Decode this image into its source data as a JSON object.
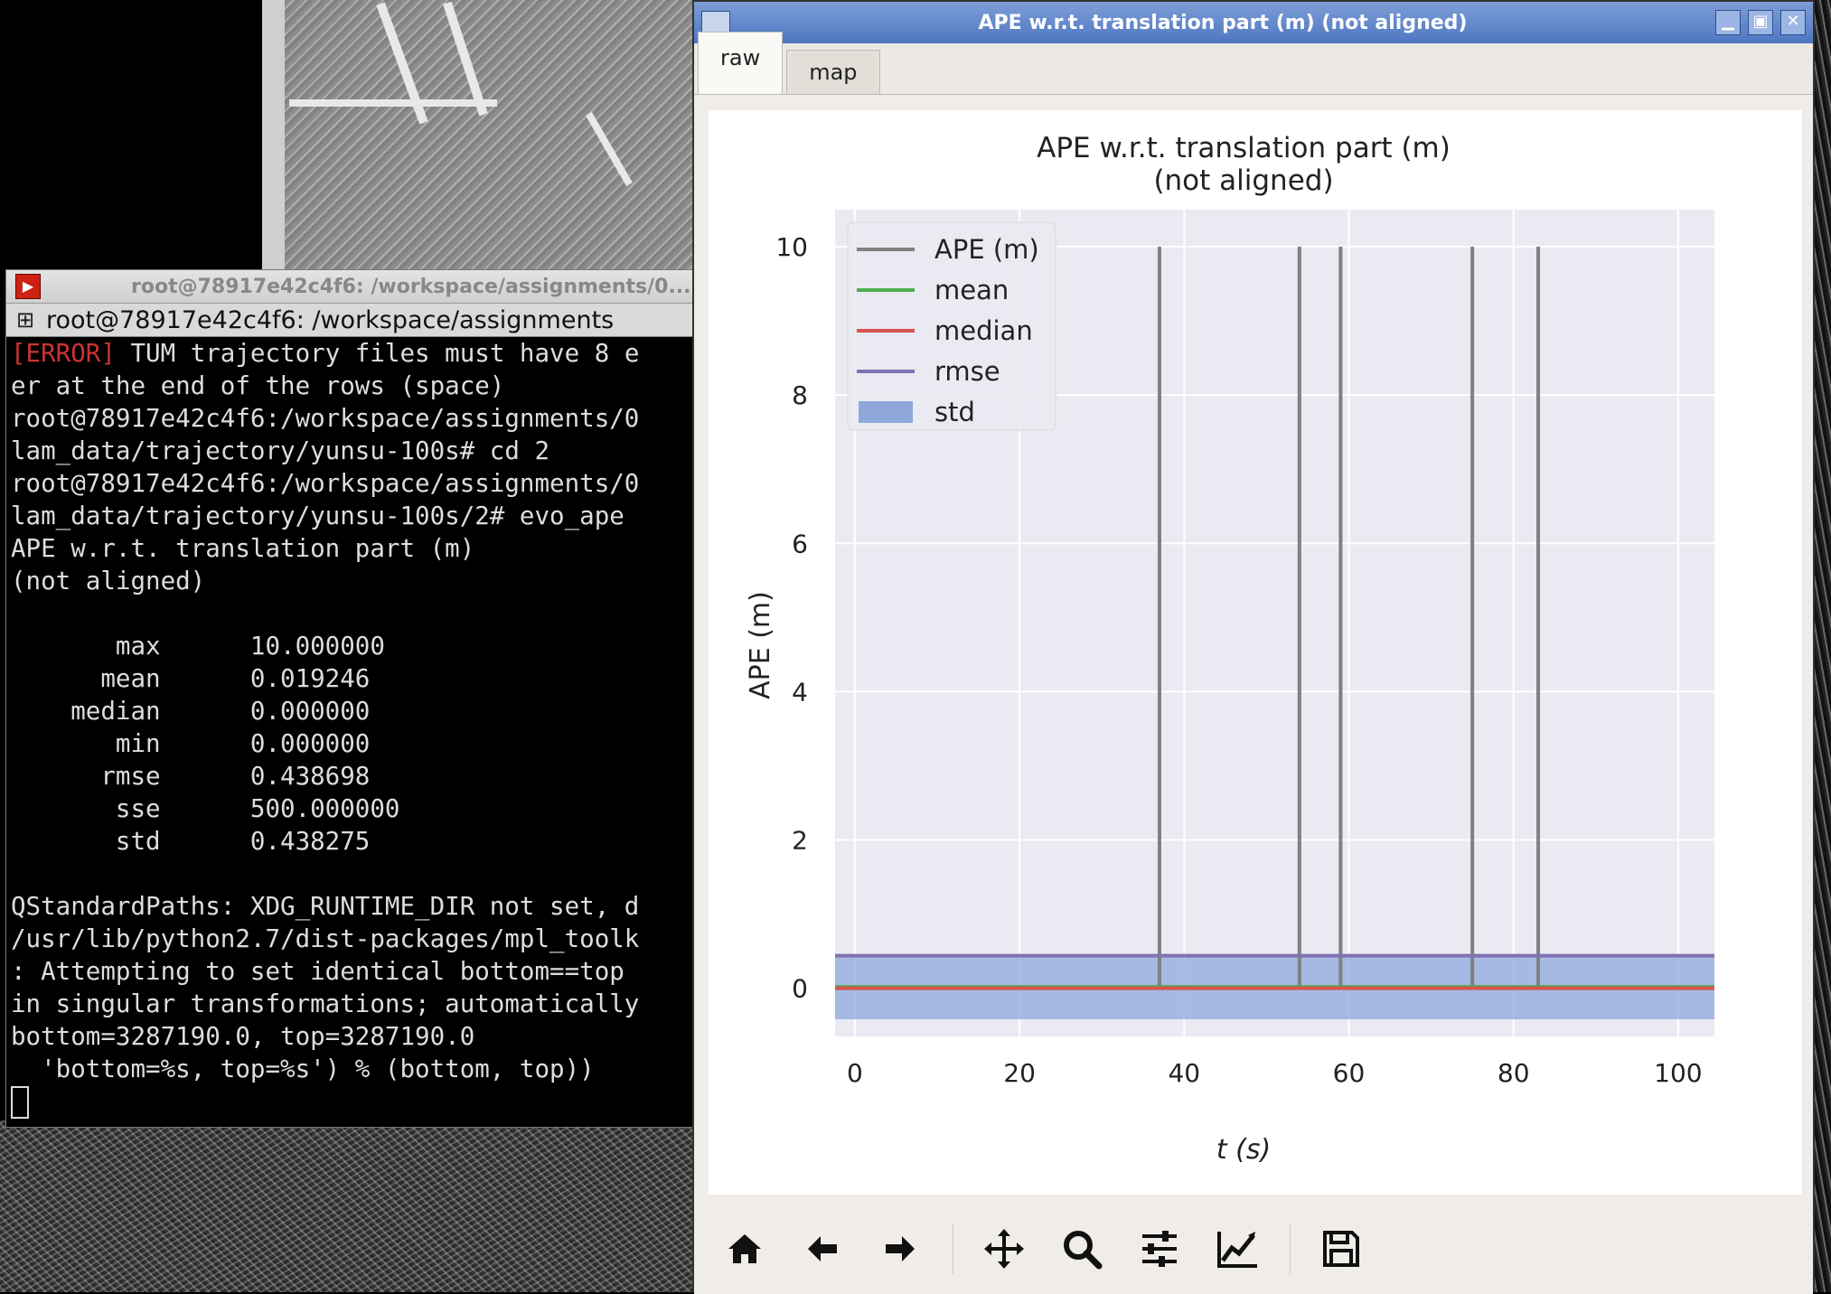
{
  "terminal": {
    "title": "root@78917e42c4f6: /workspace/assignments/0...",
    "tab_title": "root@78917e42c4f6: /workspace/assignments",
    "lines": [
      {
        "err": "[ERROR]",
        "text": " TUM trajectory files must have 8 e"
      },
      {
        "text": "er at the end of the rows (space)"
      },
      {
        "text": "root@78917e42c4f6:/workspace/assignments/0"
      },
      {
        "text": "lam_data/trajectory/yunsu-100s# cd 2"
      },
      {
        "text": "root@78917e42c4f6:/workspace/assignments/0"
      },
      {
        "text": "lam_data/trajectory/yunsu-100s/2# evo_ape "
      },
      {
        "text": "APE w.r.t. translation part (m)"
      },
      {
        "text": "(not aligned)"
      },
      {
        "text": ""
      },
      {
        "text": "       max      10.000000"
      },
      {
        "text": "      mean      0.019246"
      },
      {
        "text": "    median      0.000000"
      },
      {
        "text": "       min      0.000000"
      },
      {
        "text": "      rmse      0.438698"
      },
      {
        "text": "       sse      500.000000"
      },
      {
        "text": "       std      0.438275"
      },
      {
        "text": ""
      },
      {
        "text": "QStandardPaths: XDG_RUNTIME_DIR not set, d"
      },
      {
        "text": "/usr/lib/python2.7/dist-packages/mpl_toolk"
      },
      {
        "text": ": Attempting to set identical bottom==top "
      },
      {
        "text": "in singular transformations; automatically"
      },
      {
        "text": "bottom=3287190.0, top=3287190.0"
      },
      {
        "text": "  'bottom=%s, top=%s') % (bottom, top))"
      }
    ]
  },
  "plot_window": {
    "title": "APE w.r.t. translation part (m) (not aligned)",
    "tabs": [
      "raw",
      "map"
    ],
    "active_tab": "raw",
    "toolbar": [
      "home-icon",
      "back-icon",
      "forward-icon",
      "pan-icon",
      "zoom-icon",
      "configure-subplots-icon",
      "edit-axis-icon",
      "save-icon"
    ]
  },
  "chart_data": {
    "type": "line",
    "title": "APE w.r.t. translation part (m)",
    "subtitle": "(not aligned)",
    "xlabel": "t (s)",
    "ylabel": "APE (m)",
    "xlim": [
      -2.4,
      104.4
    ],
    "ylim": [
      -0.65,
      10.5
    ],
    "xticks": [
      0,
      20,
      40,
      60,
      80,
      100
    ],
    "yticks": [
      0,
      2,
      4,
      6,
      8,
      10
    ],
    "grid": true,
    "legend_position": "top-left",
    "legend": [
      {
        "label": "APE (m)",
        "color": "#808080",
        "kind": "line"
      },
      {
        "label": "mean",
        "color": "#4caf50",
        "kind": "line"
      },
      {
        "label": "median",
        "color": "#d9534f",
        "kind": "line"
      },
      {
        "label": "rmse",
        "color": "#8172b2",
        "kind": "line"
      },
      {
        "label": "std",
        "color": "#8fa8dc",
        "kind": "patch"
      }
    ],
    "series": [
      {
        "name": "APE (m)",
        "spikes_x": [
          37,
          54,
          59,
          75,
          83
        ],
        "spike_y": 10,
        "baseline": 0
      },
      {
        "name": "mean",
        "value": 0.019246
      },
      {
        "name": "median",
        "value": 0.0
      },
      {
        "name": "rmse",
        "value": 0.438698
      },
      {
        "name": "std",
        "value": 0.438275
      }
    ]
  }
}
